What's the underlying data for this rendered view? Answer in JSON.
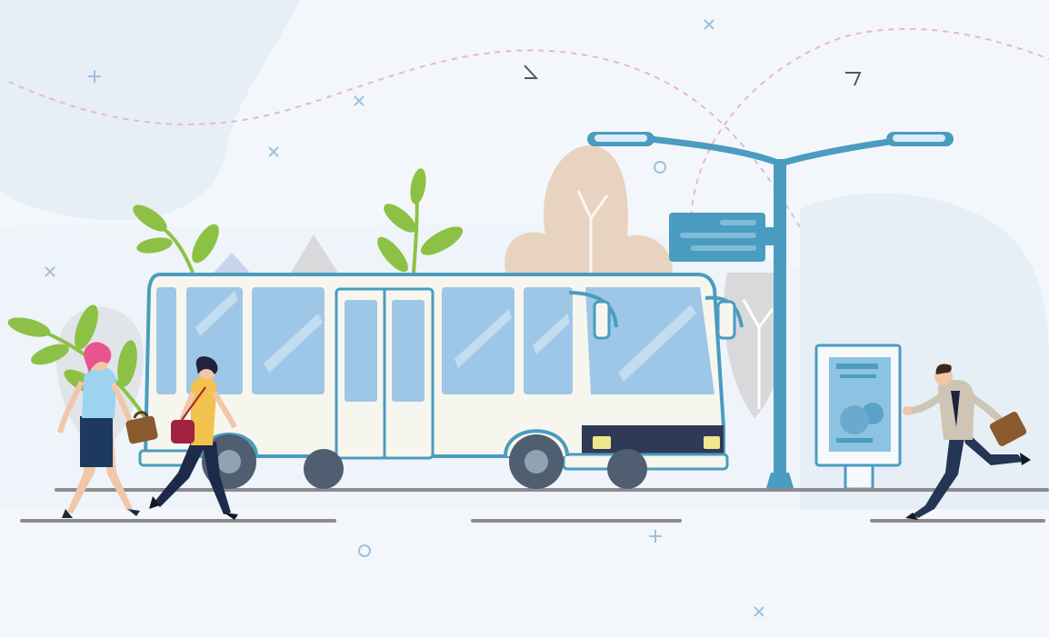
{
  "scene": {
    "subject": "city-bus-stop-illustration",
    "elements": [
      "bus",
      "street-lamp",
      "bus-stop-sign",
      "advertising-board",
      "woman-with-briefcase",
      "woman-with-handbag",
      "running-businessman",
      "plants",
      "background-buildings",
      "decorative-marks"
    ]
  },
  "palette": {
    "background": "#f3f7fb",
    "soft_blob": "#e6eef6",
    "bus_body": "#f7f6ee",
    "bus_outline": "#4a9cc0",
    "window": "#9ec6e6",
    "window_shine": "#c2dcf0",
    "lamp": "#4a9cc0",
    "lamp_light": "#d9ecf7",
    "leaf": "#8dc145",
    "road": "#8f8a8f",
    "building_beige": "#e7d3bf",
    "tree_grey": "#d9d9dc",
    "dashed_line": "#e7b8c6",
    "bus_front": "#2f3b56",
    "headlight": "#f0e68c",
    "wheel": "#4f5e70"
  }
}
